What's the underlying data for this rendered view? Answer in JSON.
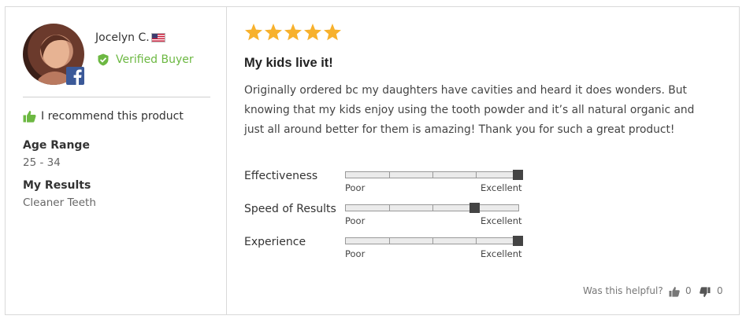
{
  "reviewer": {
    "name": "Jocelyn C.",
    "flag_icon": "us-flag-icon",
    "badge_icon": "facebook-icon",
    "verified_label": "Verified Buyer"
  },
  "recommend": {
    "text": "I recommend this product",
    "icon": "thumbs-up-icon"
  },
  "attributes": [
    {
      "label": "Age Range",
      "value": "25 - 34"
    },
    {
      "label": "My Results",
      "value": "Cleaner Teeth"
    }
  ],
  "review": {
    "rating": 5,
    "max_rating": 5,
    "title": "My kids live it!",
    "body": "Originally ordered bc my daughters have cavities and heard it does wonders. But knowing that my kids enjoy using the tooth powder and it’s all natural organic and just all around better for them is amazing! Thank you for such a great product!"
  },
  "sliders": [
    {
      "label": "Effectiveness",
      "min_label": "Poor",
      "max_label": "Excellent",
      "level": 1.0
    },
    {
      "label": "Speed of Results",
      "min_label": "Poor",
      "max_label": "Excellent",
      "level": 0.75
    },
    {
      "label": "Experience",
      "min_label": "Poor",
      "max_label": "Excellent",
      "level": 1.0
    }
  ],
  "footer": {
    "helpful_label": "Was this helpful?",
    "up_count": "0",
    "down_count": "0"
  },
  "colors": {
    "star": "#f7b12d",
    "verified": "#6cb842",
    "border": "#d9d9d9"
  }
}
